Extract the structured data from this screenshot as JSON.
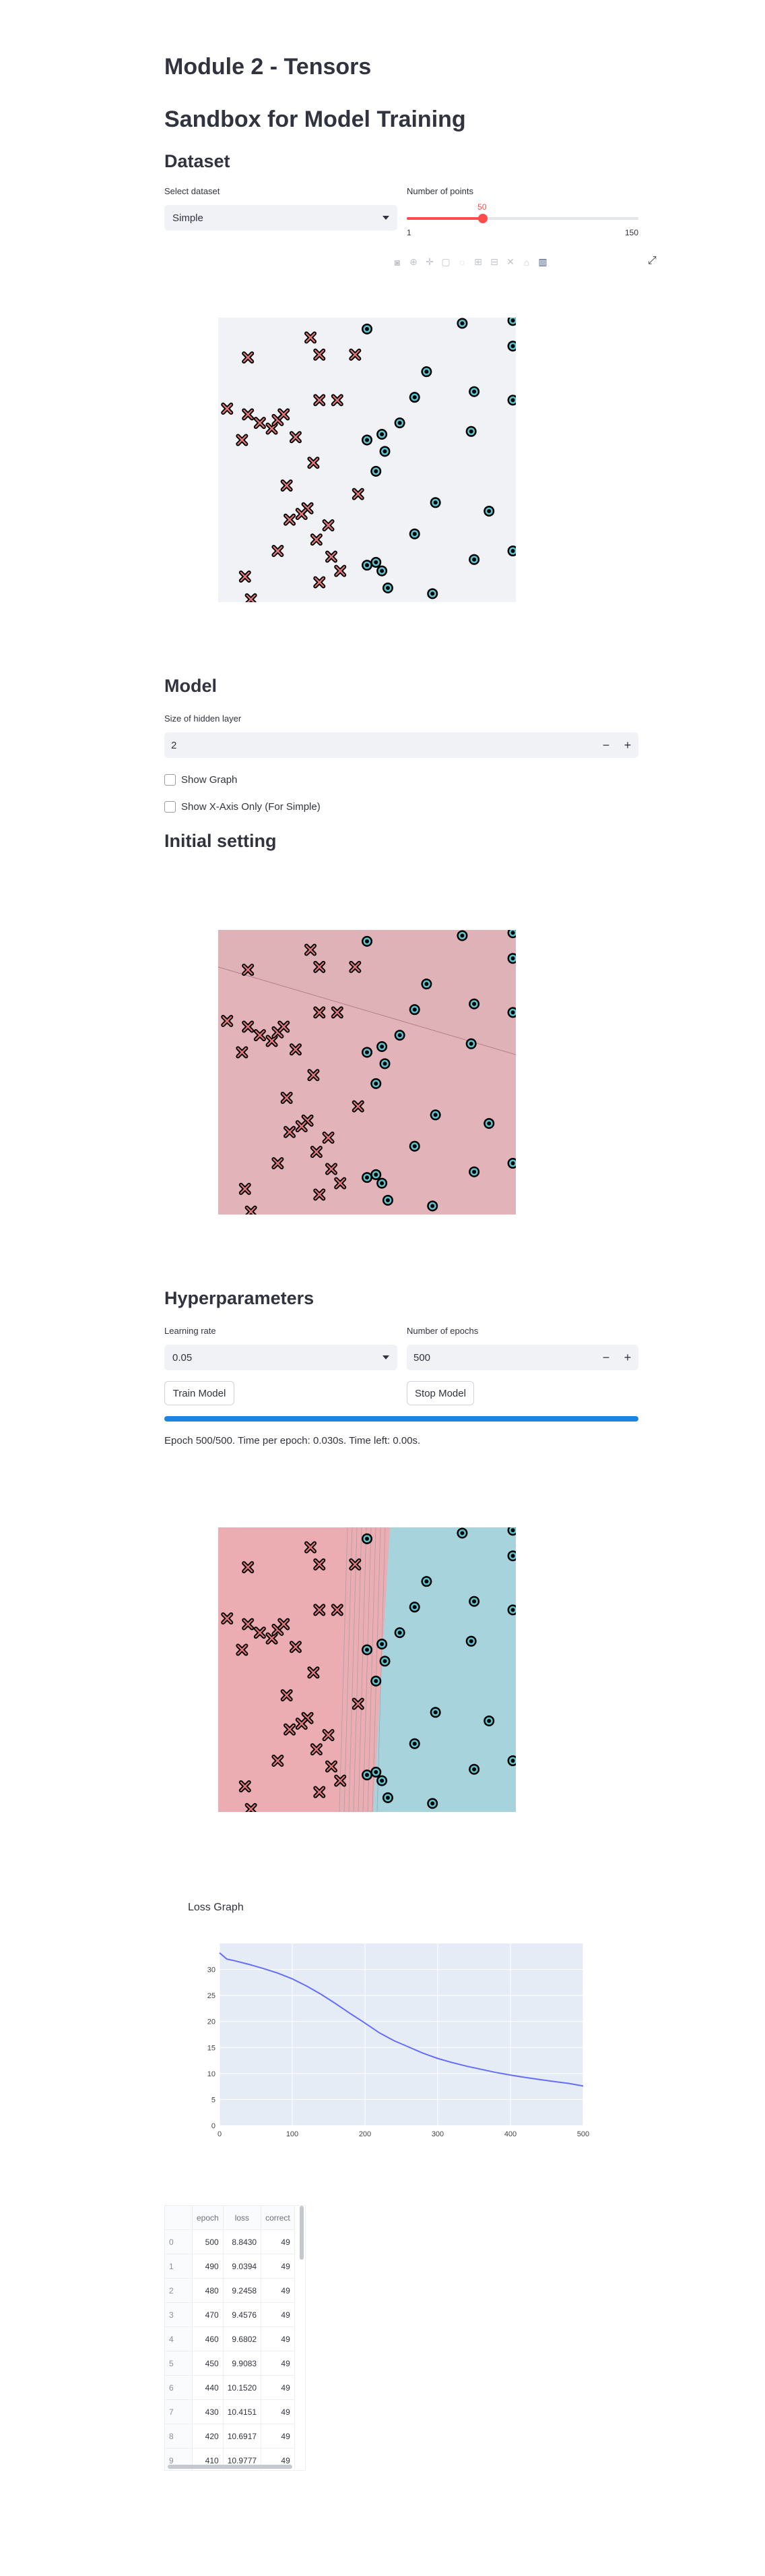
{
  "page": {
    "title": "Module 2 - Tensors",
    "subtitle": "Sandbox for Model Training"
  },
  "dataset": {
    "heading": "Dataset",
    "select_label": "Select dataset",
    "select_value": "Simple",
    "points_label": "Number of points",
    "points_value": "50",
    "points_min": "1",
    "points_max": "150",
    "points_fraction": 0.329
  },
  "toolbar_icons": [
    "camera-icon",
    "zoom-icon",
    "pan-icon",
    "box-select-icon",
    "lasso-icon",
    "zoom-in-icon",
    "zoom-out-icon",
    "autoscale-icon",
    "home-icon",
    "plotly-logo-icon"
  ],
  "model": {
    "heading": "Model",
    "hidden_label": "Size of hidden layer",
    "hidden_value": "2",
    "minus": "−",
    "plus": "+",
    "show_graph": "Show Graph",
    "show_x_axis": "Show X-Axis Only (For Simple)"
  },
  "initial": {
    "heading": "Initial setting"
  },
  "hyper": {
    "heading": "Hyperparameters",
    "lr_label": "Learning rate",
    "lr_value": "0.05",
    "epochs_label": "Number of epochs",
    "epochs_value": "500",
    "train_button": "Train Model",
    "stop_button": "Stop Model",
    "progress": 1.0,
    "status": "Epoch 500/500. Time per epoch: 0.030s. Time left: 0.00s."
  },
  "colors": {
    "red_class": "#e8a4a8",
    "blue_class": "#a6d3dc",
    "initial_bg": "#ddb6bc",
    "plot_bg": "#e5ecf6",
    "progress": "#1c83e1",
    "slider": "#ff4b4b",
    "loss_line": "#636efa"
  },
  "points": {
    "x_points": [
      [
        0.1,
        0.86
      ],
      [
        0.31,
        0.93
      ],
      [
        0.34,
        0.87
      ],
      [
        0.46,
        0.87
      ],
      [
        0.03,
        0.68
      ],
      [
        0.1,
        0.66
      ],
      [
        0.14,
        0.63
      ],
      [
        0.18,
        0.61
      ],
      [
        0.2,
        0.64
      ],
      [
        0.22,
        0.66
      ],
      [
        0.08,
        0.57
      ],
      [
        0.26,
        0.58
      ],
      [
        0.34,
        0.71
      ],
      [
        0.4,
        0.71
      ],
      [
        0.32,
        0.49
      ],
      [
        0.23,
        0.41
      ],
      [
        0.3,
        0.33
      ],
      [
        0.24,
        0.29
      ],
      [
        0.28,
        0.31
      ],
      [
        0.47,
        0.38
      ],
      [
        0.37,
        0.27
      ],
      [
        0.2,
        0.18
      ],
      [
        0.33,
        0.22
      ],
      [
        0.38,
        0.16
      ],
      [
        0.41,
        0.11
      ],
      [
        0.09,
        0.09
      ],
      [
        0.34,
        0.07
      ],
      [
        0.11,
        0.01
      ]
    ],
    "o_points": [
      [
        0.82,
        0.98
      ],
      [
        0.99,
        0.99
      ],
      [
        0.5,
        0.96
      ],
      [
        0.99,
        0.9
      ],
      [
        0.7,
        0.81
      ],
      [
        0.66,
        0.72
      ],
      [
        0.86,
        0.74
      ],
      [
        0.99,
        0.71
      ],
      [
        0.61,
        0.63
      ],
      [
        0.55,
        0.59
      ],
      [
        0.85,
        0.6
      ],
      [
        0.56,
        0.53
      ],
      [
        0.5,
        0.57
      ],
      [
        0.53,
        0.46
      ],
      [
        0.73,
        0.35
      ],
      [
        0.91,
        0.32
      ],
      [
        0.66,
        0.24
      ],
      [
        0.86,
        0.15
      ],
      [
        0.99,
        0.18
      ],
      [
        0.53,
        0.14
      ],
      [
        0.5,
        0.13
      ],
      [
        0.55,
        0.11
      ],
      [
        0.57,
        0.05
      ],
      [
        0.72,
        0.03
      ]
    ]
  },
  "loss_graph": {
    "title": "Loss Graph"
  },
  "chart_data": {
    "type": "line",
    "title": "Loss Graph",
    "xlabel": "",
    "ylabel": "",
    "x": [
      0,
      10,
      20,
      40,
      60,
      80,
      100,
      120,
      140,
      160,
      180,
      200,
      220,
      240,
      260,
      280,
      300,
      320,
      340,
      360,
      380,
      400,
      420,
      440,
      460,
      480,
      500
    ],
    "values": [
      33.2,
      32.0,
      31.7,
      31.0,
      30.2,
      29.3,
      28.2,
      26.8,
      25.2,
      23.4,
      21.5,
      19.7,
      17.8,
      16.3,
      15.1,
      13.9,
      12.9,
      12.1,
      11.4,
      10.8,
      10.2,
      9.7,
      9.25,
      8.85,
      8.46,
      8.1,
      7.6
    ],
    "xlim": [
      0,
      500
    ],
    "ylim": [
      0,
      35
    ],
    "xticks": [
      "0",
      "100",
      "200",
      "300",
      "400",
      "500"
    ],
    "yticks": [
      "0",
      "5",
      "10",
      "15",
      "20",
      "25",
      "30"
    ],
    "grid": true
  },
  "table": {
    "columns": [
      "",
      "epoch",
      "loss",
      "correct"
    ],
    "rows": [
      [
        "0",
        "500",
        "8.8430",
        "49"
      ],
      [
        "1",
        "490",
        "9.0394",
        "49"
      ],
      [
        "2",
        "480",
        "9.2458",
        "49"
      ],
      [
        "3",
        "470",
        "9.4576",
        "49"
      ],
      [
        "4",
        "460",
        "9.6802",
        "49"
      ],
      [
        "5",
        "450",
        "9.9083",
        "49"
      ],
      [
        "6",
        "440",
        "10.1520",
        "49"
      ],
      [
        "7",
        "430",
        "10.4151",
        "49"
      ],
      [
        "8",
        "420",
        "10.6917",
        "49"
      ],
      [
        "9",
        "410",
        "10.9777",
        "49"
      ]
    ]
  }
}
